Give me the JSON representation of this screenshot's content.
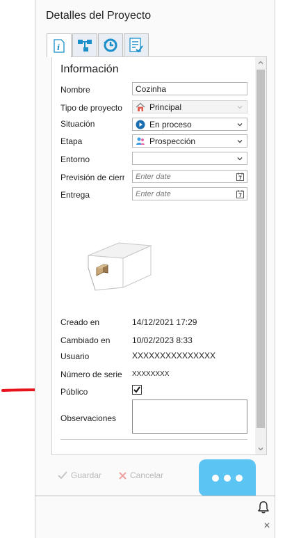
{
  "panel": {
    "title": "Detalles del Proyecto",
    "tabs": [
      {
        "icon": "info-icon",
        "active": true
      },
      {
        "icon": "hierarchy-icon",
        "active": false
      },
      {
        "icon": "history-icon",
        "active": false
      },
      {
        "icon": "checklist-icon",
        "active": false
      }
    ]
  },
  "info": {
    "section_title": "Información",
    "nombre_label": "Nombre",
    "nombre_value": "Cozinha",
    "tipo_label": "Tipo de proyecto",
    "tipo_value": "Principal",
    "situacion_label": "Situación",
    "situacion_value": "En proceso",
    "etapa_label": "Etapa",
    "etapa_value": "Prospección",
    "entorno_label": "Entorno",
    "entorno_value": "",
    "prevision_label": "Previsión de cierre",
    "prevision_placeholder": "Enter date",
    "entrega_label": "Entrega",
    "entrega_placeholder": "Enter date",
    "creado_label": "Creado en",
    "creado_value": "14/12/2021 17:29",
    "cambiado_label": "Cambiado en",
    "cambiado_value": "10/02/2023 8:33",
    "usuario_label": "Usuario",
    "usuario_value": "XXXXXXXXXXXXXXX",
    "serie_label": "Número de serie",
    "serie_value": "XXXXXXXX",
    "publico_label": "Público",
    "publico_checked": true,
    "observaciones_label": "Observaciones",
    "observaciones_value": ""
  },
  "footer": {
    "save_label": "Guardar",
    "cancel_label": "Cancelar"
  },
  "colors": {
    "accent": "#5bc4f2",
    "annotation_arrow": "#e8141b",
    "tab_icon": "#1a8fc9"
  }
}
